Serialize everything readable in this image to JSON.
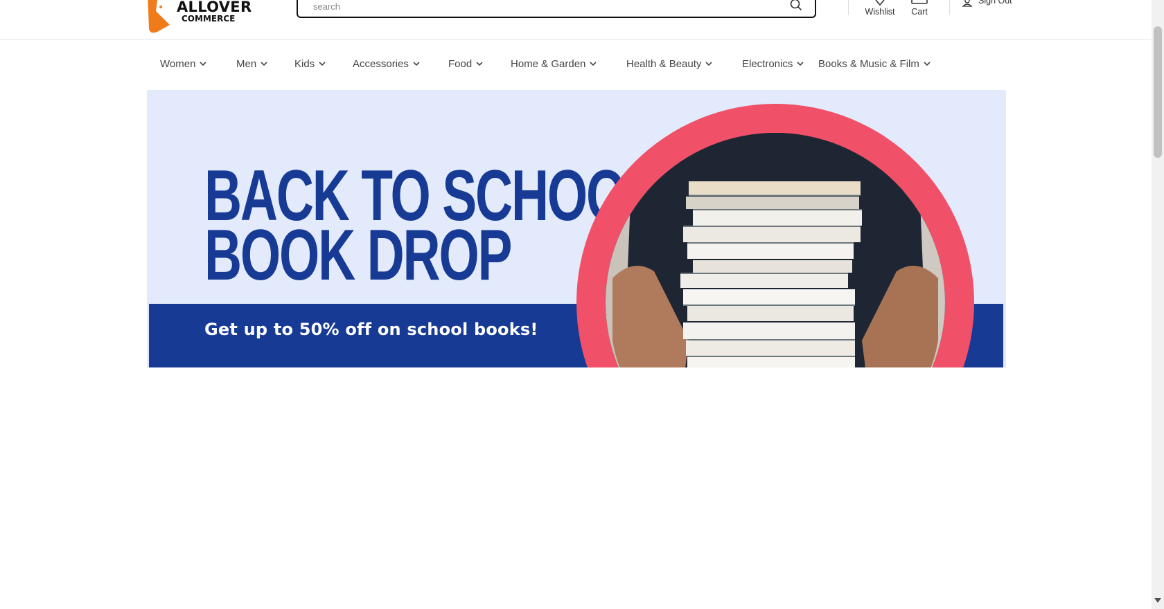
{
  "header": {
    "logo_name": "ALLOVER",
    "logo_sub": "COMMERCE",
    "search_placeholder": "search",
    "wishlist_label": "Wishlist",
    "cart_label": "Cart",
    "signout_label": "Sign Out"
  },
  "nav": {
    "items": [
      {
        "label": "Women"
      },
      {
        "label": "Men"
      },
      {
        "label": "Kids"
      },
      {
        "label": "Accessories"
      },
      {
        "label": "Food"
      },
      {
        "label": "Home & Garden"
      },
      {
        "label": "Health & Beauty"
      },
      {
        "label": "Electronics"
      },
      {
        "label": "Books & Music & Film"
      }
    ]
  },
  "banner": {
    "headline_line1": "BACK TO SCHOOL",
    "headline_line2": "BOOK DROP",
    "subheadline": "Get up to 50% off on school books!"
  },
  "colors": {
    "brand_blue": "#173a95",
    "banner_bg": "#e2eafb",
    "ring": "#f05068",
    "logo_orange": "#f07b1a"
  },
  "icons": {
    "logo": "allover-logo-mark",
    "search": "search-icon",
    "wishlist": "heart-icon",
    "cart": "cart-icon",
    "signout": "user-icon",
    "nav_chevron": "chevron-down-icon"
  }
}
